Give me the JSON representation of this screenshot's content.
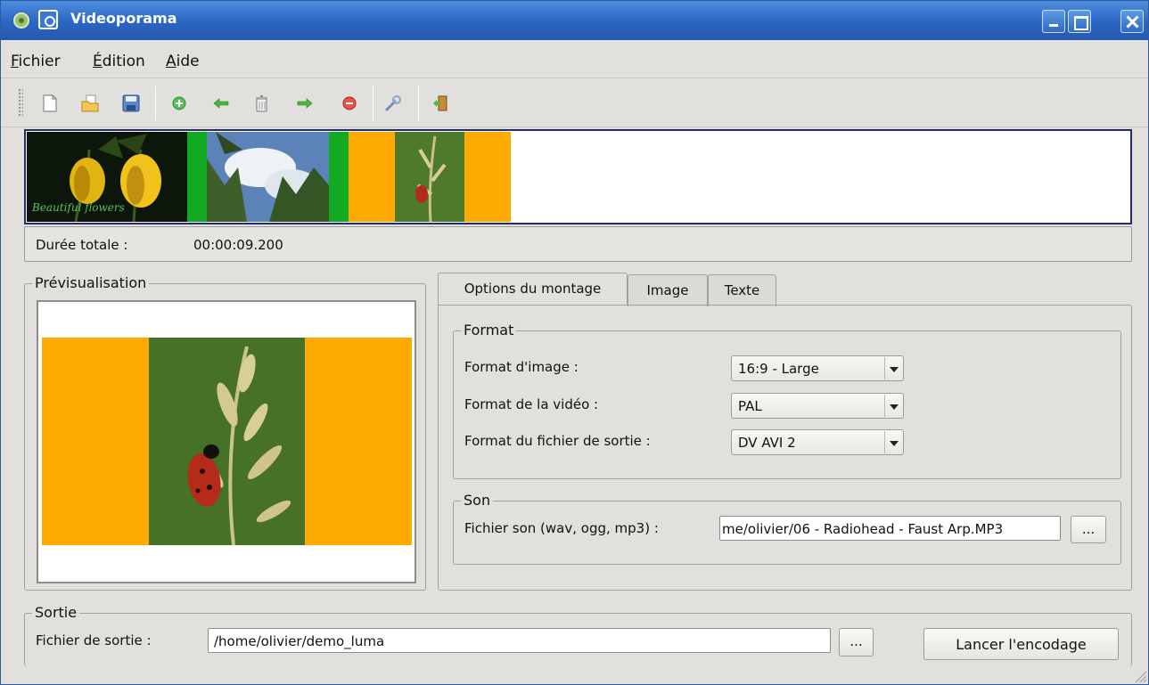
{
  "window": {
    "title": "Videoporama"
  },
  "menu": [
    {
      "accel": "F",
      "rest": "ichier"
    },
    {
      "accel": "É",
      "rest": "dition"
    },
    {
      "accel": "A",
      "rest": "ide"
    }
  ],
  "toolbar": {
    "icons": [
      "new-file-icon",
      "open-folder-icon",
      "save-icon",
      "add-icon",
      "move-left-icon",
      "delete-image-icon",
      "move-right-icon",
      "remove-icon",
      "settings-wrench-icon",
      "exit-icon"
    ]
  },
  "filmstrip": {
    "caption": "Beautiful flowers",
    "colors": {
      "orange": "#ffaa00",
      "green": "#11aa22"
    }
  },
  "duration": {
    "label": "Durée totale :",
    "value": "00:00:09.200"
  },
  "preview": {
    "title": "Prévisualisation"
  },
  "tabs": [
    "Options du montage",
    "Image",
    "Texte"
  ],
  "format": {
    "title": "Format",
    "rows": [
      {
        "label": "Format d'image :",
        "value": "16:9 - Large"
      },
      {
        "label": "Format de la vidéo :",
        "value": "PAL"
      },
      {
        "label": "Format du fichier de sortie :",
        "value": "DV AVI 2"
      }
    ]
  },
  "son": {
    "title": "Son",
    "label": "Fichier son (wav, ogg, mp3) :",
    "value": "me/olivier/06 - Radiohead - Faust Arp.MP3",
    "browse": "..."
  },
  "sortie": {
    "title": "Sortie",
    "label": "Fichier de sortie :",
    "value": "/home/olivier/demo_luma",
    "browse": "...",
    "encode": "Lancer l'encodage"
  }
}
